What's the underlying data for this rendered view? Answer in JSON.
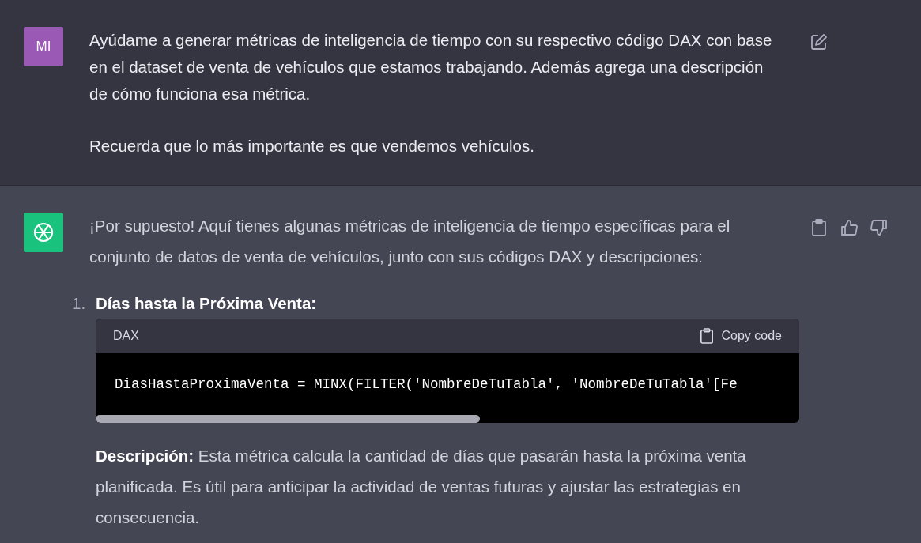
{
  "messages": [
    {
      "kind": "user",
      "avatar": "MI",
      "paragraphs": [
        "Ayúdame a generar métricas de inteligencia de tiempo con su respectivo código DAX con base en el dataset de venta de vehículos que estamos trabajando. Además agrega una descripción de cómo funciona esa métrica.",
        "Recuerda que lo más importante es que vendemos vehículos."
      ]
    },
    {
      "kind": "assistant",
      "paragraphs": [
        "¡Por supuesto! Aquí tienes algunas métricas de inteligencia de tiempo específicas para el conjunto de datos de venta de vehículos, junto con sus códigos DAX y descripciones:"
      ],
      "list": [
        {
          "number": "1.",
          "title": "Días hasta la Próxima Venta:",
          "code": {
            "language": "DAX",
            "copy_label": "Copy code",
            "line": "DiasHastaProximaVenta = MINX(FILTER('NombreDeTuTabla', 'NombreDeTuTabla'[Fe"
          },
          "description": "**Descripción:** Esta métrica calcula la cantidad de días que pasarán hasta la próxima venta planificada. Es útil para anticipar la actividad de ventas futuras y ajustar las estrategias en consecuencia."
        }
      ]
    }
  ]
}
